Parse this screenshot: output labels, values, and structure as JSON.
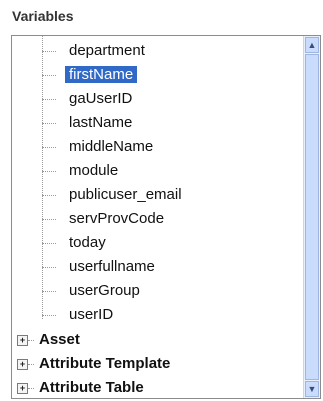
{
  "panel": {
    "title": "Variables"
  },
  "tree": {
    "leaves": [
      {
        "label": "department"
      },
      {
        "label": "firstName",
        "selected": true
      },
      {
        "label": "gaUserID"
      },
      {
        "label": "lastName"
      },
      {
        "label": "middleName"
      },
      {
        "label": "module"
      },
      {
        "label": "publicuser_email"
      },
      {
        "label": "servProvCode"
      },
      {
        "label": "today"
      },
      {
        "label": "userfullname"
      },
      {
        "label": "userGroup"
      },
      {
        "label": "userID"
      }
    ],
    "folders": [
      {
        "label": "Asset",
        "expander": "+"
      },
      {
        "label": "Attribute Template",
        "expander": "+"
      },
      {
        "label": "Attribute Table",
        "expander": "+"
      }
    ]
  },
  "scrollbar": {
    "up_icon": "chevron-up-icon",
    "down_icon": "chevron-down-icon",
    "up_glyph": "▲",
    "down_glyph": "▼"
  }
}
